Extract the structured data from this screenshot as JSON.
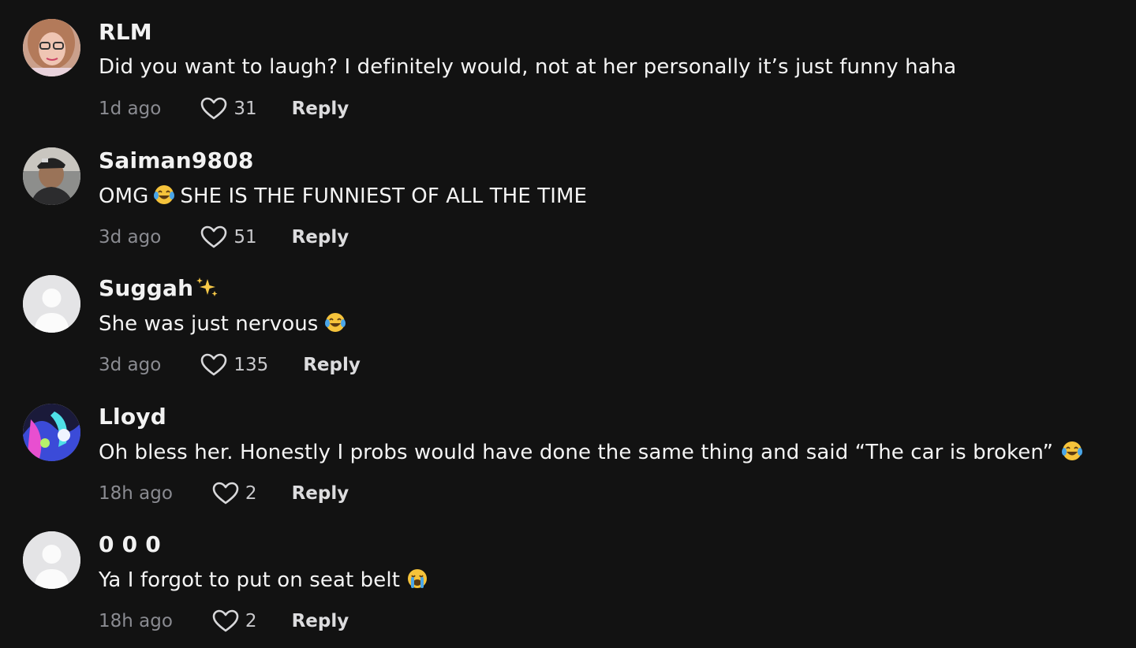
{
  "comments": [
    {
      "username": "RLM",
      "text": "Did you want to laugh? I definitely would, not at her personally it’s just funny haha",
      "time": "1d ago",
      "likes": "31",
      "reply_label": "Reply",
      "avatar": "photo-woman-glasses"
    },
    {
      "username": "Saiman9808",
      "text_before": "OMG",
      "text_after": "SHE IS THE FUNNIEST OF ALL THE TIME",
      "time": "3d ago",
      "likes": "51",
      "reply_label": "Reply",
      "avatar": "photo-man-cap"
    },
    {
      "username": "Suggah",
      "text": "She was just nervous",
      "time": "3d ago",
      "likes": "135",
      "reply_label": "Reply",
      "avatar": "default-avatar"
    },
    {
      "username": "Lloyd",
      "text": "Oh bless her. Honestly I probs would have done the same thing and said “The car is broken”",
      "time": "18h ago",
      "likes": "2",
      "reply_label": "Reply",
      "avatar": "photo-colorful"
    },
    {
      "username": "0 0 0",
      "text": "Ya I forgot to put on seat belt",
      "time": "18h ago",
      "likes": "2",
      "reply_label": "Reply",
      "avatar": "default-avatar"
    }
  ],
  "colors": {
    "background": "#121212",
    "username": "#f2f2f2",
    "timestamp": "#8a8b91",
    "reply": "#dcdcde"
  },
  "icons": {
    "like": "heart-outline-icon",
    "laugh": "tears-of-joy-emoji",
    "sparkles": "sparkles-emoji",
    "cry": "loudly-crying-emoji"
  }
}
